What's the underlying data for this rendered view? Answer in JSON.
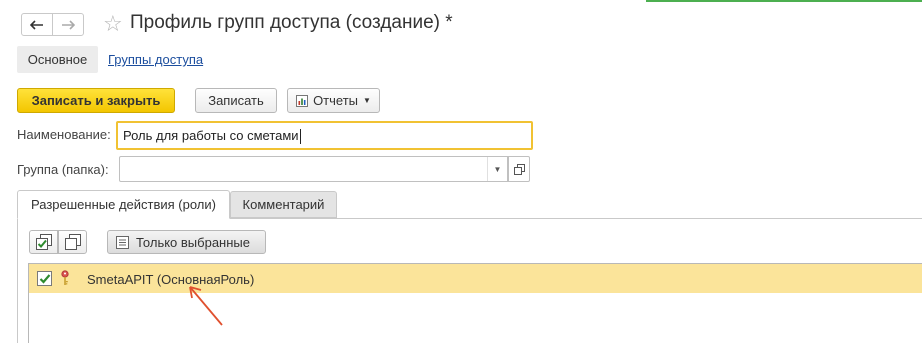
{
  "window": {
    "title": "Профиль групп доступа (создание) *",
    "favorite_icon": "star-icon"
  },
  "nav": {
    "back_icon": "arrow-left-icon",
    "forward_icon": "arrow-right-icon"
  },
  "sections": {
    "main_label": "Основное",
    "groups_link": "Группы доступа"
  },
  "toolbar": {
    "save_close_label": "Записать и закрыть",
    "save_label": "Записать",
    "reports_label": "Отчеты"
  },
  "form": {
    "name_label": "Наименование:",
    "name_value": "Роль для работы со сметами",
    "group_label": "Группа (папка):",
    "group_value": ""
  },
  "tabs": [
    {
      "label": "Разрешенные действия (роли)",
      "active": true
    },
    {
      "label": "Комментарий",
      "active": false
    }
  ],
  "roles_panel": {
    "only_selected_label": "Только выбранные",
    "items": [
      {
        "label": "SmetaAPIT (ОсновнаяРоль)",
        "checked": true
      }
    ]
  },
  "colors": {
    "primary_button": "#f3c600",
    "selected_row": "#fbe49a",
    "input_focus": "#f1c232",
    "link": "#1c4e9e",
    "annotation_arrow": "#e0502e"
  }
}
